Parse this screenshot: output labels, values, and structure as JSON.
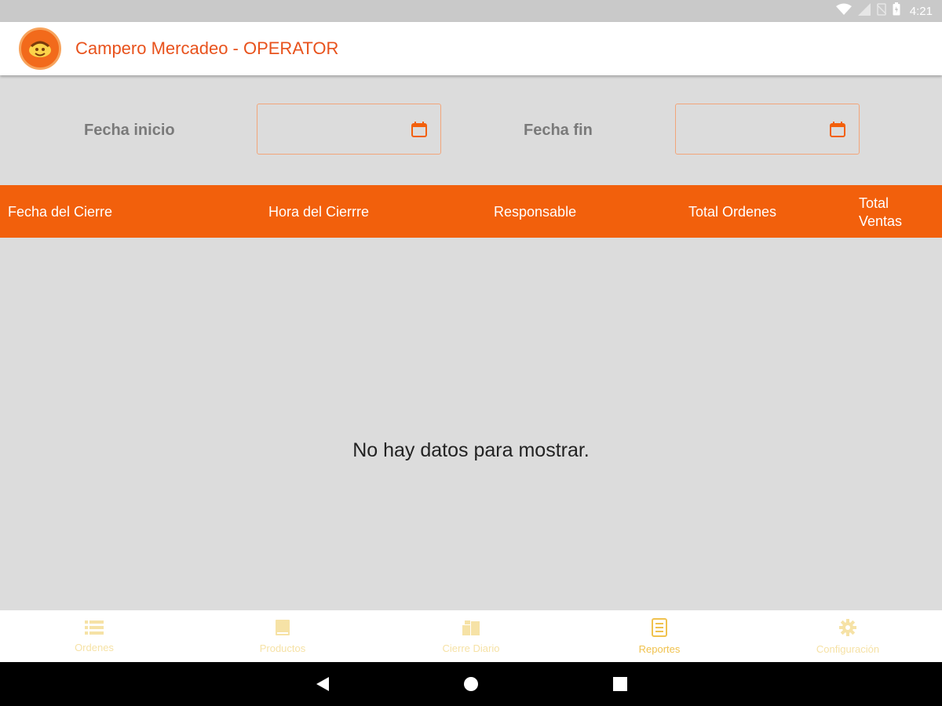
{
  "status_bar": {
    "time": "4:21",
    "icons": [
      "wifi-icon",
      "signal-icon",
      "no-sim-icon",
      "battery-icon"
    ]
  },
  "app_bar": {
    "title": "Campero Mercadeo - OPERATOR",
    "logo_icon": "campero-logo-icon"
  },
  "filters": {
    "start_label": "Fecha inicio",
    "end_label": "Fecha fin",
    "start_value": "",
    "end_value": "",
    "icon": "calendar-icon"
  },
  "table": {
    "columns": [
      "Fecha del Cierre",
      "Hora del Cierrre",
      "Responsable",
      "Total Ordenes",
      "Total Ventas"
    ],
    "rows": [],
    "empty_message": "No hay datos para mostrar."
  },
  "bottom_nav": {
    "items": [
      {
        "label": "Ordenes",
        "icon": "list-icon"
      },
      {
        "label": "Productos",
        "icon": "book-icon"
      },
      {
        "label": "Cierre Diario",
        "icon": "boxes-icon"
      },
      {
        "label": "Reportes",
        "icon": "report-icon",
        "active": true
      },
      {
        "label": "Configuración",
        "icon": "gear-icon"
      }
    ]
  },
  "colors": {
    "primary": "#f2600c",
    "title": "#e8521c",
    "nav_active": "#f0c24e",
    "nav_inactive": "#f6e2a6",
    "background": "#dcdcdc"
  }
}
